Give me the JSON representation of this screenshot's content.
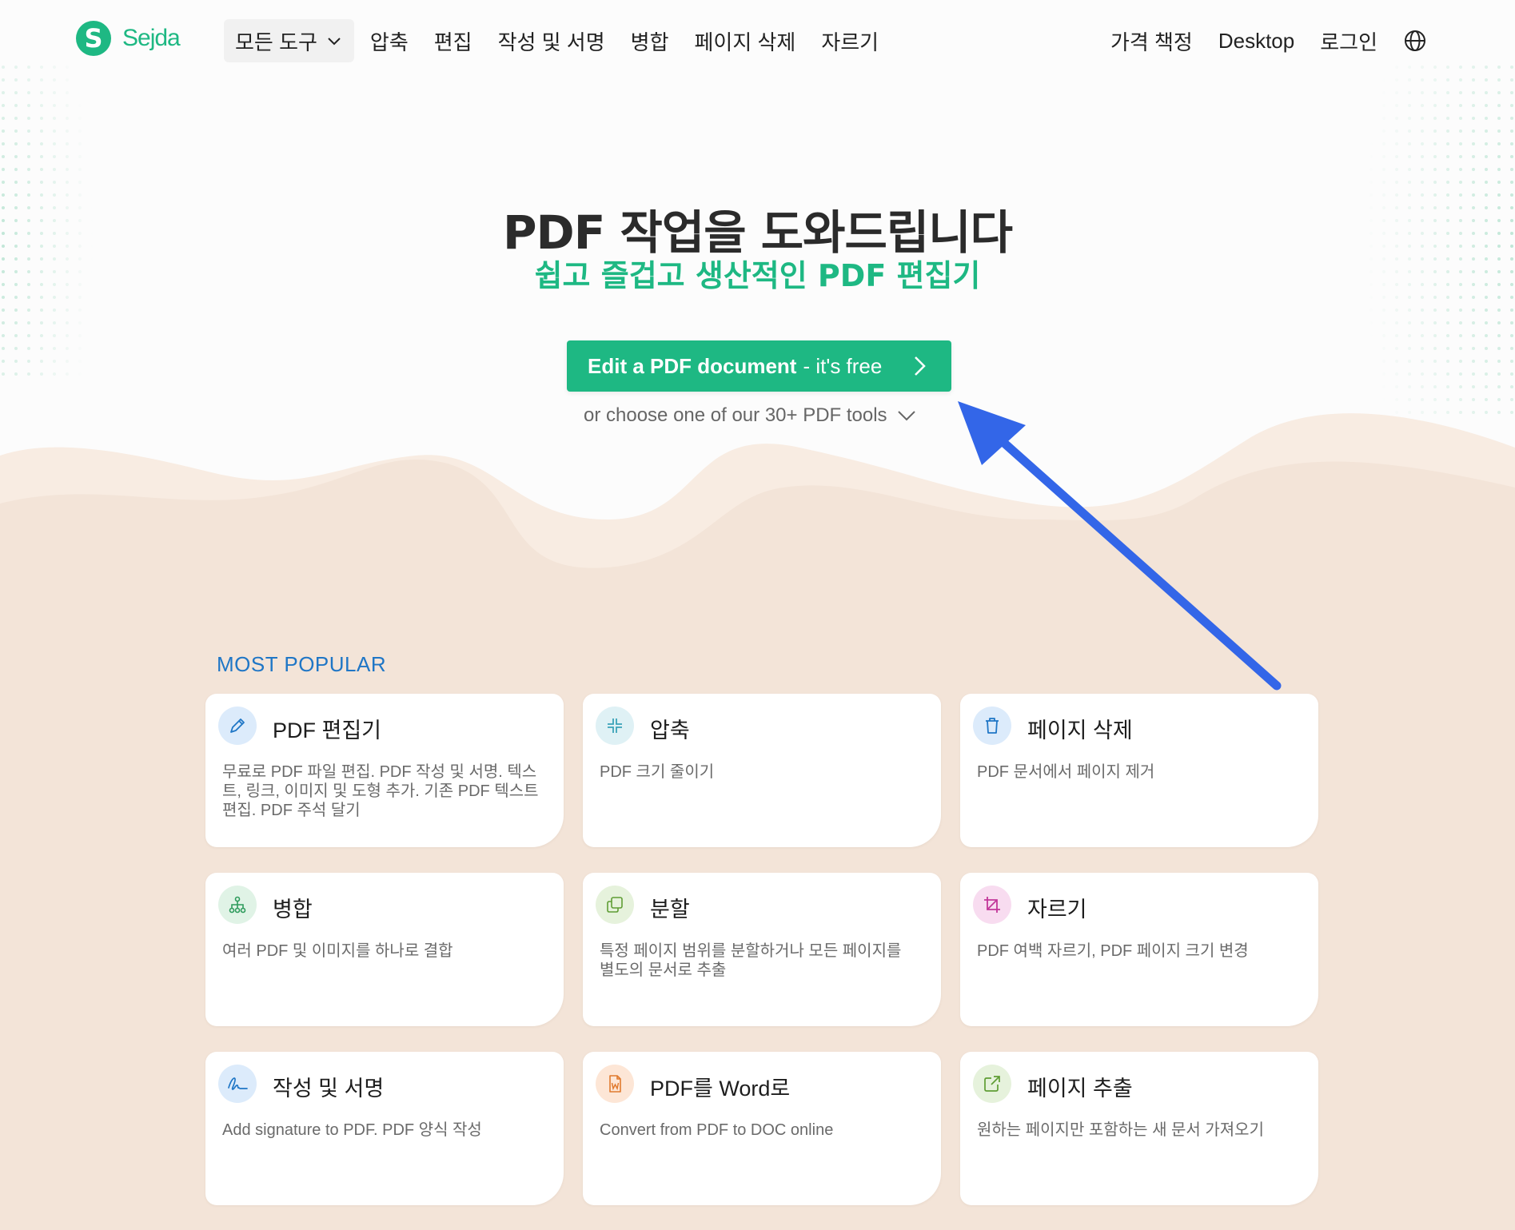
{
  "brand": {
    "name": "Sejda",
    "mark": "S",
    "color": "#1eb883"
  },
  "nav": {
    "all_tools": "모든 도구",
    "items": [
      "압축",
      "편집",
      "작성 및 서명",
      "병합",
      "페이지 삭제",
      "자르기"
    ],
    "right": {
      "pricing": "가격 책정",
      "desktop": "Desktop",
      "login": "로그인"
    }
  },
  "hero": {
    "title": "PDF 작업을 도와드립니다",
    "subtitle": "쉽고 즐겁고 생산적인 PDF 편집기",
    "cta_strong": "Edit a PDF document",
    "cta_light": "- it's free",
    "choose_text": "or choose one of our 30+ PDF tools"
  },
  "popular": {
    "label": "MOST POPULAR",
    "cards": [
      {
        "title": "PDF 편집기",
        "desc": "무료로 PDF 파일 편집. PDF 작성 및 서명. 텍스트, 링크, 이미지 및 도형 추가. 기존 PDF 텍스트 편집. PDF 주석 달기",
        "icon": "pencil-icon",
        "icon_bg": "#dcebfb",
        "icon_color": "#1f76c6"
      },
      {
        "title": "압축",
        "desc": "PDF 크기 줄이기",
        "icon": "compress-icon",
        "icon_bg": "#dff1f5",
        "icon_color": "#3aa3b8"
      },
      {
        "title": "페이지 삭제",
        "desc": "PDF 문서에서 페이지 제거",
        "icon": "trash-icon",
        "icon_bg": "#dcebfb",
        "icon_color": "#1f76c6"
      },
      {
        "title": "병합",
        "desc": "여러 PDF 및 이미지를 하나로 결합",
        "icon": "merge-icon",
        "icon_bg": "#e0f3e6",
        "icon_color": "#2e9b5c"
      },
      {
        "title": "분할",
        "desc": "특정 페이지 범위를 분할하거나 모든 페이지를 별도의 문서로 추출",
        "icon": "split-icon",
        "icon_bg": "#e6f2dc",
        "icon_color": "#5f9d34"
      },
      {
        "title": "자르기",
        "desc": "PDF 여백 자르기, PDF 페이지 크기 변경",
        "icon": "crop-icon",
        "icon_bg": "#f8dcf0",
        "icon_color": "#c2379a"
      },
      {
        "title": "작성 및 서명",
        "desc": "Add signature to PDF. PDF 양식 작성",
        "icon": "signature-icon",
        "icon_bg": "#dcebfb",
        "icon_color": "#1f76c6"
      },
      {
        "title": "PDF를 Word로",
        "desc": "Convert from PDF to DOC online",
        "icon": "word-icon",
        "icon_bg": "#fde6d6",
        "icon_color": "#e07a2e"
      },
      {
        "title": "페이지 추출",
        "desc": "원하는 페이지만 포함하는 새 문서 가져오기",
        "icon": "extract-icon",
        "icon_bg": "#e6f2dc",
        "icon_color": "#5f9d34"
      }
    ]
  },
  "annotation": {
    "arrow_color": "#3366e8"
  }
}
